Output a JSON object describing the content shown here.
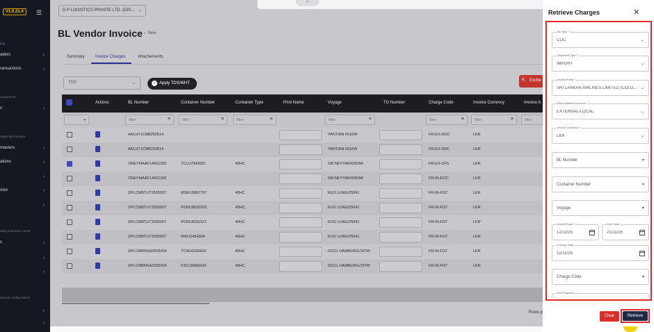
{
  "sidebar": {
    "version": "V1.0.31.4",
    "items": [
      {
        "label": "aders",
        "chev": "›"
      },
      {
        "label": "ransactions",
        "chev": "›"
      },
      {
        "label": "s",
        "chev": "›"
      },
      {
        "label": "masters",
        "chev": "›"
      },
      {
        "label": "ations",
        "chev": "›"
      },
      {
        "label": "",
        "chev": "›"
      },
      {
        "label": "oice",
        "chev": "›"
      },
      {
        "label": "",
        "chev": "›"
      },
      {
        "label": "s",
        "chev": "›"
      },
      {
        "label": "",
        "chev": "›"
      },
      {
        "label": "",
        "chev": "›"
      },
      {
        "label": "",
        "chev": "›"
      },
      {
        "label": "",
        "chev": "›"
      }
    ],
    "sections": [
      "ting",
      "anagement",
      "nagement System",
      "ating Common Center",
      "nancial configurations"
    ]
  },
  "header": {
    "company": "D P LOGISTICS PRIVATE LTD. (DPL...",
    "title": "BL Vendor Invoice",
    "breadcrumb": "New"
  },
  "tabs": [
    "Summary",
    "Invoice Charges",
    "Attachements"
  ],
  "toolbar": {
    "tds_placeholder": "TDS",
    "apply_label": "Apply TDS/WHT",
    "export_label": "Exche"
  },
  "table": {
    "columns": [
      "Actions",
      "BL Number",
      "Container Number",
      "Container Type",
      "Print Name",
      "Voyage",
      "TO Number",
      "Charge Code",
      "Invoice Currency",
      "Invoice A"
    ],
    "filter_placeholder": "filter",
    "rows": [
      {
        "bl": "AALHTJCMB250514",
        "container": "",
        "type": "",
        "voyage": "YANTIAN I/016W",
        "charge": "FR-EX-DOC",
        "currency": "LKR",
        "checked": false
      },
      {
        "bl": "AALHTJCMB250514",
        "container": "",
        "type": "",
        "voyage": "YANTIAN I/016W",
        "charge": "FR-EX-DHC",
        "currency": "LKR",
        "checked": false
      },
      {
        "bl": "ONEYMAAF14601300",
        "container": "TCLU7943051",
        "type": "40HC",
        "voyage": "SM NEYYAR/0059W",
        "charge": "FR-EX-CFS",
        "currency": "LKR",
        "checked": true
      },
      {
        "bl": "ONEYMAAF14601300",
        "container": "",
        "type": "",
        "voyage": "SM NEYYAR/0059W",
        "charge": "FR-IN-DOC",
        "currency": "LKR",
        "checked": false
      },
      {
        "bl": "DPLCMBTUT2505007",
        "container": "MSKU9897707",
        "type": "40HC",
        "voyage": "KUO LUNG/25041",
        "charge": "FR-IN-FGT",
        "currency": "LKR",
        "checked": false
      },
      {
        "bl": "DPLCMBTUT2505007",
        "container": "PONU8030202",
        "type": "40HC",
        "voyage": "KUO LUNG/25041",
        "charge": "FR-IN-FGT",
        "currency": "LKR",
        "checked": false
      },
      {
        "bl": "DPLCMBTUT2505007",
        "container": "PONU8250167",
        "type": "40HC",
        "voyage": "KUO LUNG/25041",
        "charge": "FR-IN-FGT",
        "currency": "LKR",
        "checked": false
      },
      {
        "bl": "DPLCMBTUT2505007",
        "container": "INKU2494394",
        "type": "40HC",
        "voyage": "KUO LUNG/25041",
        "charge": "FR-IN-FGT",
        "currency": "LKR",
        "checked": false
      },
      {
        "bl": "DPLCMBNSA2505004",
        "container": "TCNU6336662",
        "type": "40HC",
        "voyage": "OOCL HAMBURG/157W",
        "charge": "FR-IN-FGT",
        "currency": "LKR",
        "checked": false
      },
      {
        "bl": "DPLCMBNSA2505004",
        "container": "FSCU8465620",
        "type": "40HC",
        "voyage": "OOCL HAMBURG/157W",
        "charge": "FR-IN-FGT",
        "currency": "LKR",
        "checked": false
      }
    ],
    "rows_label": "Rows p"
  },
  "panel": {
    "title": "Retrieve Charges",
    "close": "✕",
    "fields": [
      {
        "label": "BL Type *",
        "value": "COC"
      },
      {
        "label": "Shipment Type *",
        "value": "IMPORT"
      },
      {
        "label": "Invoice Party *",
        "value": "SRI LANKAN AIRLINES LIMITED (COLO..."
      },
      {
        "label": "Reconciliation Account *",
        "value": "EXTERNAL-LOCAL"
      },
      {
        "label": "Invoice Currency *",
        "value": "LKR"
      },
      {
        "label": "",
        "value": "BL Number"
      },
      {
        "label": "",
        "value": "Container Number"
      },
      {
        "label": "",
        "value": "Voyage"
      }
    ],
    "invoice_date": {
      "label": "Invoice Date *",
      "value": "12/11/25"
    },
    "due_date": {
      "label": "Due Date",
      "value": "21/11/25"
    },
    "posting_date": {
      "label": "Posting Date",
      "value": "12/11/25"
    },
    "charge_code": "Charge Code",
    "iou_payment": "IOU Payment",
    "clear_label": "Clear",
    "retrieve_label": "Retrieve"
  }
}
